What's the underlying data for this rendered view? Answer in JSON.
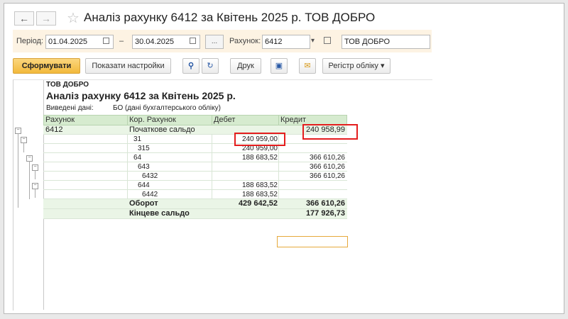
{
  "window": {
    "title": "Аналіз рахунку 6412 за Квітень 2025 р. ТОВ ДОБРО",
    "back_glyph": "←",
    "forward_glyph": "→",
    "star_glyph": "☆"
  },
  "filters": {
    "period_label": "Період:",
    "date_from": "01.04.2025",
    "dash": "–",
    "date_to": "30.04.2025",
    "more_label": "...",
    "account_label": "Рахунок:",
    "account_value": "6412",
    "org_value": "ТОВ ДОБРО"
  },
  "toolbar": {
    "generate_label": "Сформувати",
    "settings_label": "Показати настройки",
    "print_label": "Друк",
    "register_label": "Регістр обліку"
  },
  "report": {
    "org": "ТОВ ДОБРО",
    "title": "Аналіз рахунку 6412 за Квітень 2025 р.",
    "data_label": "Виведені дані:",
    "data_value": "БО (дані бухгалтерського обліку)",
    "headers": {
      "account": "Рахунок",
      "corr_account": "Кор. Рахунок",
      "debit": "Дебет",
      "credit": "Кредит"
    },
    "rows": [
      {
        "account": "6412",
        "corr": "Початкове сальдо",
        "debit": "",
        "credit": "240 958,99"
      },
      {
        "account": "",
        "corr": "31",
        "debit": "240 959,00",
        "credit": ""
      },
      {
        "account": "",
        "corr": "315",
        "debit": "240 959,00",
        "credit": ""
      },
      {
        "account": "",
        "corr": "64",
        "debit": "188 683,52",
        "credit": "366 610,26"
      },
      {
        "account": "",
        "corr": "643",
        "debit": "",
        "credit": "366 610,26"
      },
      {
        "account": "",
        "corr": "6432",
        "debit": "",
        "credit": "366 610,26"
      },
      {
        "account": "",
        "corr": "644",
        "debit": "188 683,52",
        "credit": ""
      },
      {
        "account": "",
        "corr": "6442",
        "debit": "188 683,52",
        "credit": ""
      }
    ],
    "turnover": {
      "label": "Оборот",
      "debit": "429 642,52",
      "credit": "366 610,26"
    },
    "closing": {
      "label": "Кінцеве сальдо",
      "debit": "",
      "credit": "177 926,73"
    }
  },
  "colors": {
    "accent": "#f2b93b",
    "header_green": "#d6ebcf",
    "highlight_red": "#e41e1e"
  }
}
